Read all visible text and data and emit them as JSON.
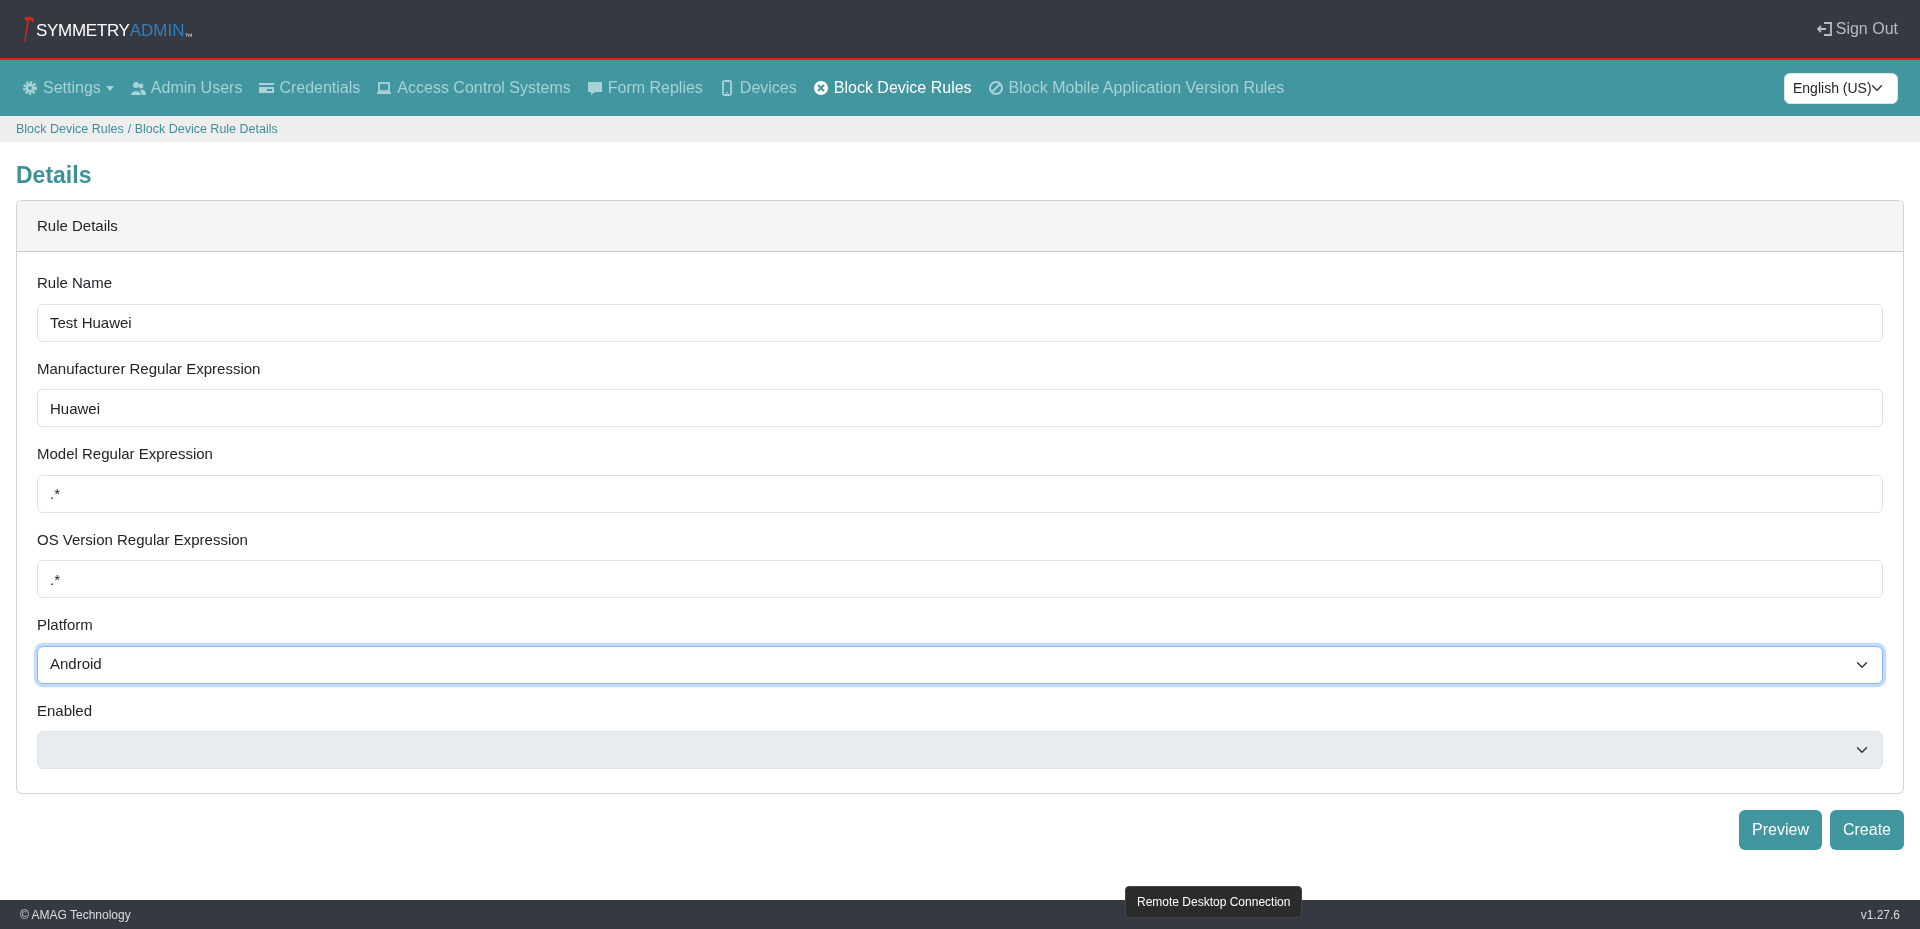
{
  "header": {
    "logo": {
      "word": "SYMMETRY",
      "accent": "ADMIN",
      "mark": "™"
    },
    "sign_out": "Sign Out"
  },
  "nav": {
    "items": [
      {
        "label": "Settings",
        "dropdown": true,
        "selected": false
      },
      {
        "label": "Admin Users",
        "dropdown": false,
        "selected": false
      },
      {
        "label": "Credentials",
        "dropdown": false,
        "selected": false
      },
      {
        "label": "Access Control Systems",
        "dropdown": false,
        "selected": false
      },
      {
        "label": "Form Replies",
        "dropdown": false,
        "selected": false
      },
      {
        "label": "Devices",
        "dropdown": false,
        "selected": false
      },
      {
        "label": "Block Device Rules",
        "dropdown": false,
        "selected": true
      },
      {
        "label": "Block Mobile Application Version Rules",
        "dropdown": false,
        "selected": false
      }
    ],
    "language": "English (US)"
  },
  "breadcrumb": [
    "Block Device Rules",
    "/ Block Device Rule Details"
  ],
  "page_title": "Details",
  "card": {
    "title": "Rule Details",
    "fields": [
      {
        "label": "Rule Name",
        "kind": "text",
        "value": "Test Huawei",
        "focused": false,
        "disabled": false
      },
      {
        "label": "Manufacturer Regular Expression",
        "kind": "text",
        "value": "Huawei",
        "focused": false,
        "disabled": false
      },
      {
        "label": "Model Regular Expression",
        "kind": "text",
        "value": ".*",
        "focused": false,
        "disabled": false
      },
      {
        "label": "OS Version Regular Expression",
        "kind": "text",
        "value": ".*",
        "focused": false,
        "disabled": false
      },
      {
        "label": "Platform",
        "kind": "select",
        "value": "Android",
        "focused": true,
        "disabled": false
      },
      {
        "label": "Enabled",
        "kind": "select",
        "focused": false,
        "disabled": true
      }
    ]
  },
  "buttons": [
    "Preview",
    "Create"
  ],
  "tooltip": "Remote Desktop Connection",
  "footer": {
    "copyright": "© AMAG Technology",
    "version": "v1.27.6"
  }
}
